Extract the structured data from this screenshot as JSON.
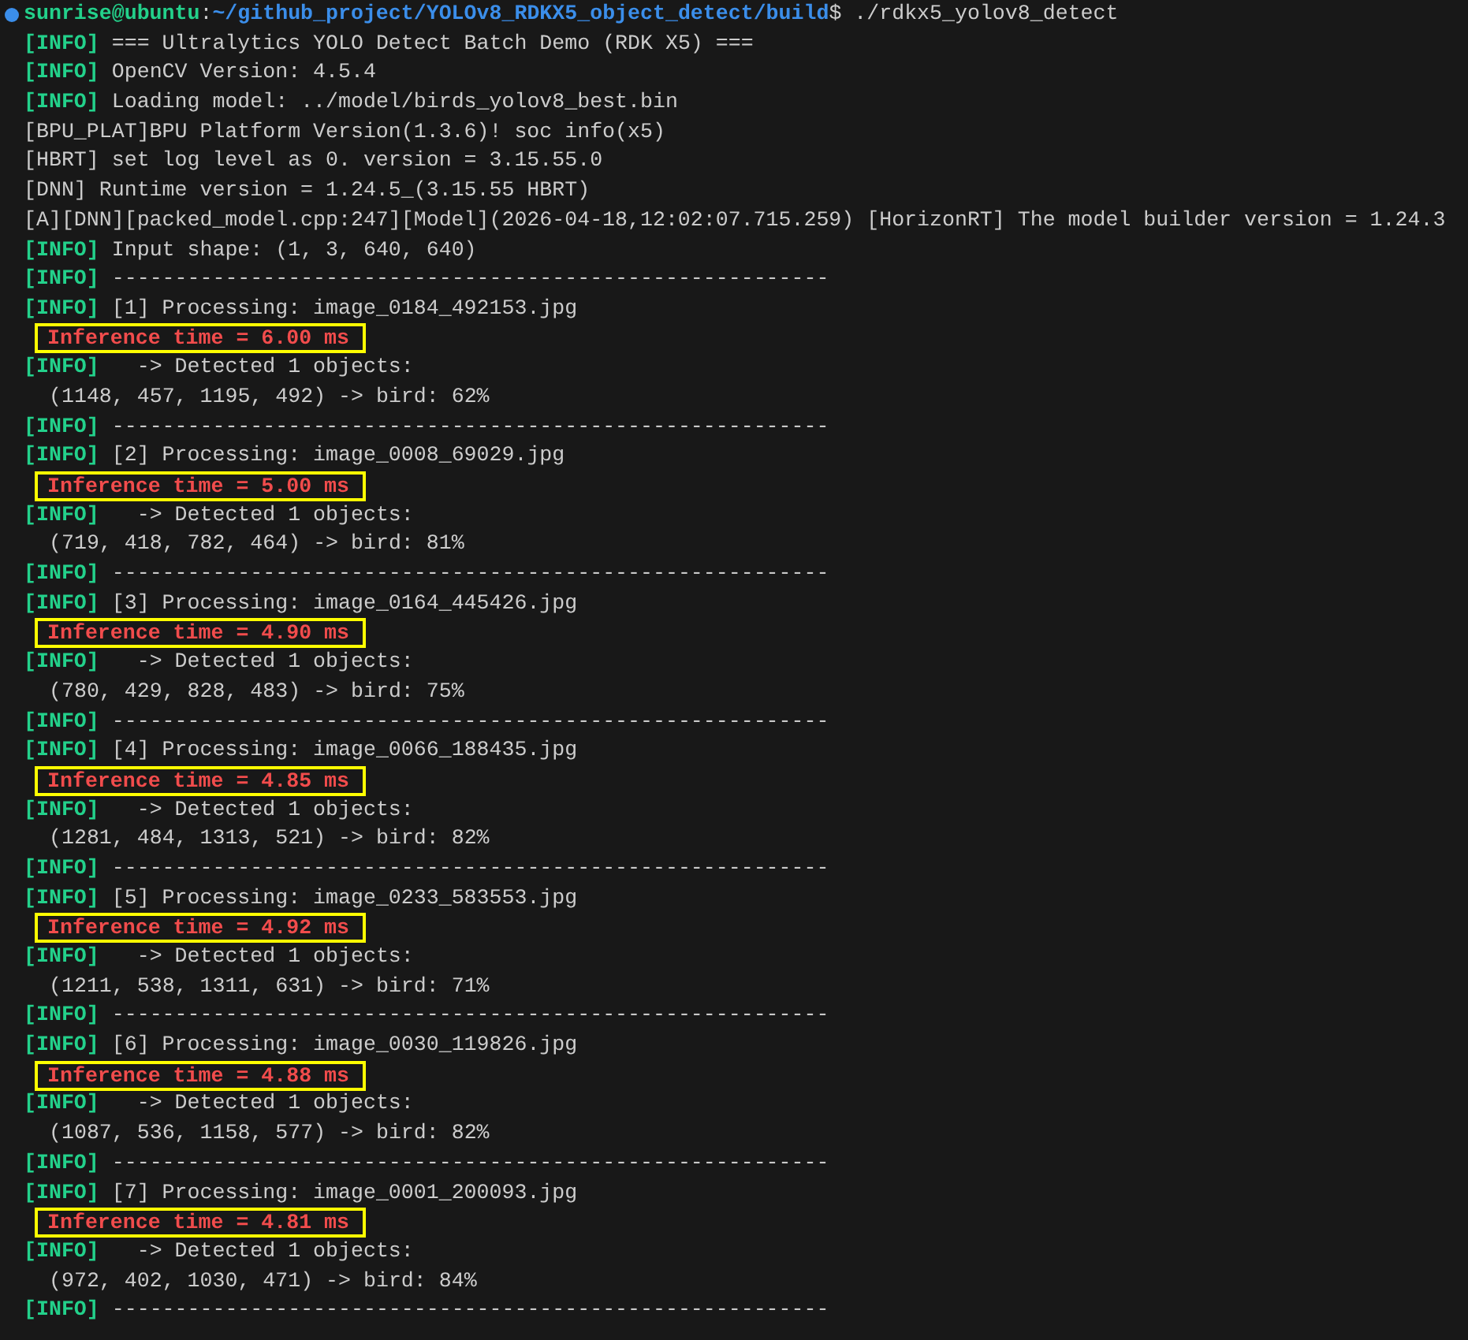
{
  "terminal": {
    "lines": [
      {
        "kind": "prompt",
        "user": "sunrise@ubuntu",
        "separator": ":",
        "path": "~/github_project/YOLOv8_RDKX5_object_detect/build",
        "command": "$ ./rdkx5_yolov8_detect"
      },
      {
        "kind": "info",
        "tag": "[INFO]",
        "text": "=== Ultralytics YOLO Detect Batch Demo (RDK X5) ==="
      },
      {
        "kind": "info",
        "tag": "[INFO]",
        "text": "OpenCV Version: 4.5.4"
      },
      {
        "kind": "info",
        "tag": "[INFO]",
        "text": "Loading model: ../model/birds_yolov8_best.bin"
      },
      {
        "kind": "plain",
        "text": "[BPU_PLAT]BPU Platform Version(1.3.6)! soc info(x5)"
      },
      {
        "kind": "plain",
        "text": "[HBRT] set log level as 0. version = 3.15.55.0"
      },
      {
        "kind": "plain",
        "text": "[DNN] Runtime version = 1.24.5_(3.15.55 HBRT)"
      },
      {
        "kind": "plain",
        "text": "[A][DNN][packed_model.cpp:247][Model](2026-04-18,12:02:07.715.259) [HorizonRT] The model builder version = 1.24.3"
      },
      {
        "kind": "info",
        "tag": "[INFO]",
        "text": "Input shape: (1, 3, 640, 640)"
      },
      {
        "kind": "info",
        "tag": "[INFO]",
        "text": "---------------------------------------------------------"
      },
      {
        "kind": "info",
        "tag": "[INFO]",
        "text": "[1] Processing: image_0184_492153.jpg"
      },
      {
        "kind": "timing",
        "text": "Inference time = 6.00 ms"
      },
      {
        "kind": "info",
        "tag": "[INFO]",
        "text": "  -> Detected 1 objects:"
      },
      {
        "kind": "result",
        "text": "(1148, 457, 1195, 492) -> bird: 62%"
      },
      {
        "kind": "info",
        "tag": "[INFO]",
        "text": "---------------------------------------------------------"
      },
      {
        "kind": "info",
        "tag": "[INFO]",
        "text": "[2] Processing: image_0008_69029.jpg"
      },
      {
        "kind": "timing",
        "text": "Inference time = 5.00 ms"
      },
      {
        "kind": "info",
        "tag": "[INFO]",
        "text": "  -> Detected 1 objects:"
      },
      {
        "kind": "result",
        "text": "(719, 418, 782, 464) -> bird: 81%"
      },
      {
        "kind": "info",
        "tag": "[INFO]",
        "text": "---------------------------------------------------------"
      },
      {
        "kind": "info",
        "tag": "[INFO]",
        "text": "[3] Processing: image_0164_445426.jpg"
      },
      {
        "kind": "timing",
        "text": "Inference time = 4.90 ms"
      },
      {
        "kind": "info",
        "tag": "[INFO]",
        "text": "  -> Detected 1 objects:"
      },
      {
        "kind": "result",
        "text": "(780, 429, 828, 483) -> bird: 75%"
      },
      {
        "kind": "info",
        "tag": "[INFO]",
        "text": "---------------------------------------------------------"
      },
      {
        "kind": "info",
        "tag": "[INFO]",
        "text": "[4] Processing: image_0066_188435.jpg"
      },
      {
        "kind": "timing",
        "text": "Inference time = 4.85 ms"
      },
      {
        "kind": "info",
        "tag": "[INFO]",
        "text": "  -> Detected 1 objects:"
      },
      {
        "kind": "result",
        "text": "(1281, 484, 1313, 521) -> bird: 82%"
      },
      {
        "kind": "info",
        "tag": "[INFO]",
        "text": "---------------------------------------------------------"
      },
      {
        "kind": "info",
        "tag": "[INFO]",
        "text": "[5] Processing: image_0233_583553.jpg"
      },
      {
        "kind": "timing",
        "text": "Inference time = 4.92 ms"
      },
      {
        "kind": "info",
        "tag": "[INFO]",
        "text": "  -> Detected 1 objects:"
      },
      {
        "kind": "result",
        "text": "(1211, 538, 1311, 631) -> bird: 71%"
      },
      {
        "kind": "info",
        "tag": "[INFO]",
        "text": "---------------------------------------------------------"
      },
      {
        "kind": "info",
        "tag": "[INFO]",
        "text": "[6] Processing: image_0030_119826.jpg"
      },
      {
        "kind": "timing",
        "text": "Inference time = 4.88 ms"
      },
      {
        "kind": "info",
        "tag": "[INFO]",
        "text": "  -> Detected 1 objects:"
      },
      {
        "kind": "result",
        "text": "(1087, 536, 1158, 577) -> bird: 82%"
      },
      {
        "kind": "info",
        "tag": "[INFO]",
        "text": "---------------------------------------------------------"
      },
      {
        "kind": "info",
        "tag": "[INFO]",
        "text": "[7] Processing: image_0001_200093.jpg"
      },
      {
        "kind": "timing",
        "text": "Inference time = 4.81 ms"
      },
      {
        "kind": "info",
        "tag": "[INFO]",
        "text": "  -> Detected 1 objects:"
      },
      {
        "kind": "result",
        "text": "(972, 402, 1030, 471) -> bird: 84%"
      },
      {
        "kind": "info",
        "tag": "[INFO]",
        "text": "---------------------------------------------------------"
      }
    ]
  }
}
